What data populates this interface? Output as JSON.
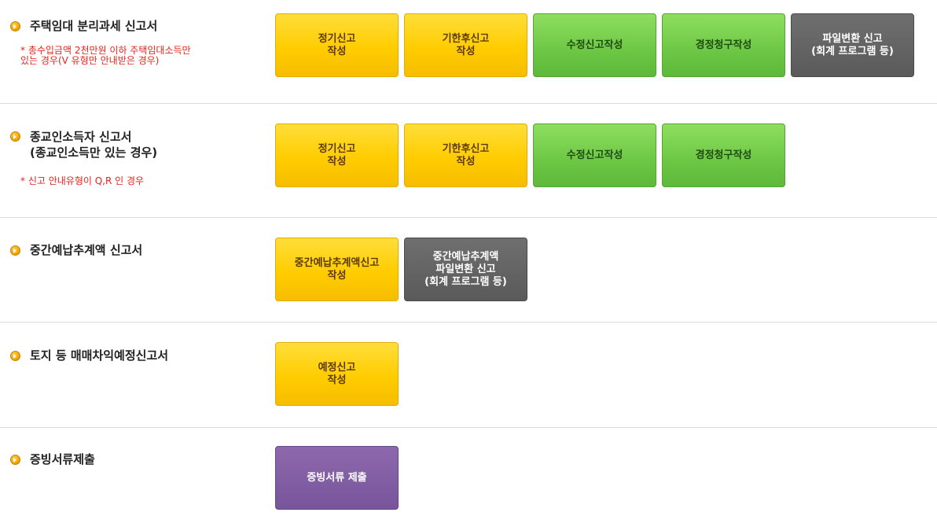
{
  "sections": [
    {
      "title": "주택임대 분리과세 신고서",
      "note": "* 총수입금액 2천만원 이하 주택임대소득만\n있는 경우(V 유형만 안내받은 경우)",
      "buttons": [
        {
          "label": "정기신고\n작성",
          "style": "yellow"
        },
        {
          "label": "기한후신고\n작성",
          "style": "yellow"
        },
        {
          "label": "수정신고작성",
          "style": "green"
        },
        {
          "label": "경정청구작성",
          "style": "green"
        },
        {
          "label": "파일변환 신고\n(회계 프로그램 등)",
          "style": "gray"
        }
      ]
    },
    {
      "title": "종교인소득자 신고서\n(종교인소득만 있는 경우)",
      "note": "* 신고 안내유형이 Q,R 인 경우",
      "buttons": [
        {
          "label": "정기신고\n작성",
          "style": "yellow"
        },
        {
          "label": "기한후신고\n작성",
          "style": "yellow"
        },
        {
          "label": "수정신고작성",
          "style": "green"
        },
        {
          "label": "경정청구작성",
          "style": "green"
        }
      ]
    },
    {
      "title": "중간예납추계액 신고서",
      "buttons": [
        {
          "label": "중간예납추계액신고\n작성",
          "style": "yellow"
        },
        {
          "label": "중간예납추계액\n파일변환 신고\n(회계 프로그램 등)",
          "style": "gray"
        }
      ]
    },
    {
      "title": "토지 등 매매차익예정신고서",
      "buttons": [
        {
          "label": "예정신고\n작성",
          "style": "yellow"
        }
      ]
    },
    {
      "title": "증빙서류제출",
      "buttons": [
        {
          "label": "증빙서류 제출",
          "style": "purple"
        }
      ]
    }
  ],
  "colors": {
    "yellow": "#ffcc00",
    "green": "#6cc744",
    "gray": "#5a5a5a",
    "purple": "#78559b",
    "note_red": "#e8231c"
  },
  "icons": {
    "bullet": "orange-circle-arrow-icon"
  }
}
